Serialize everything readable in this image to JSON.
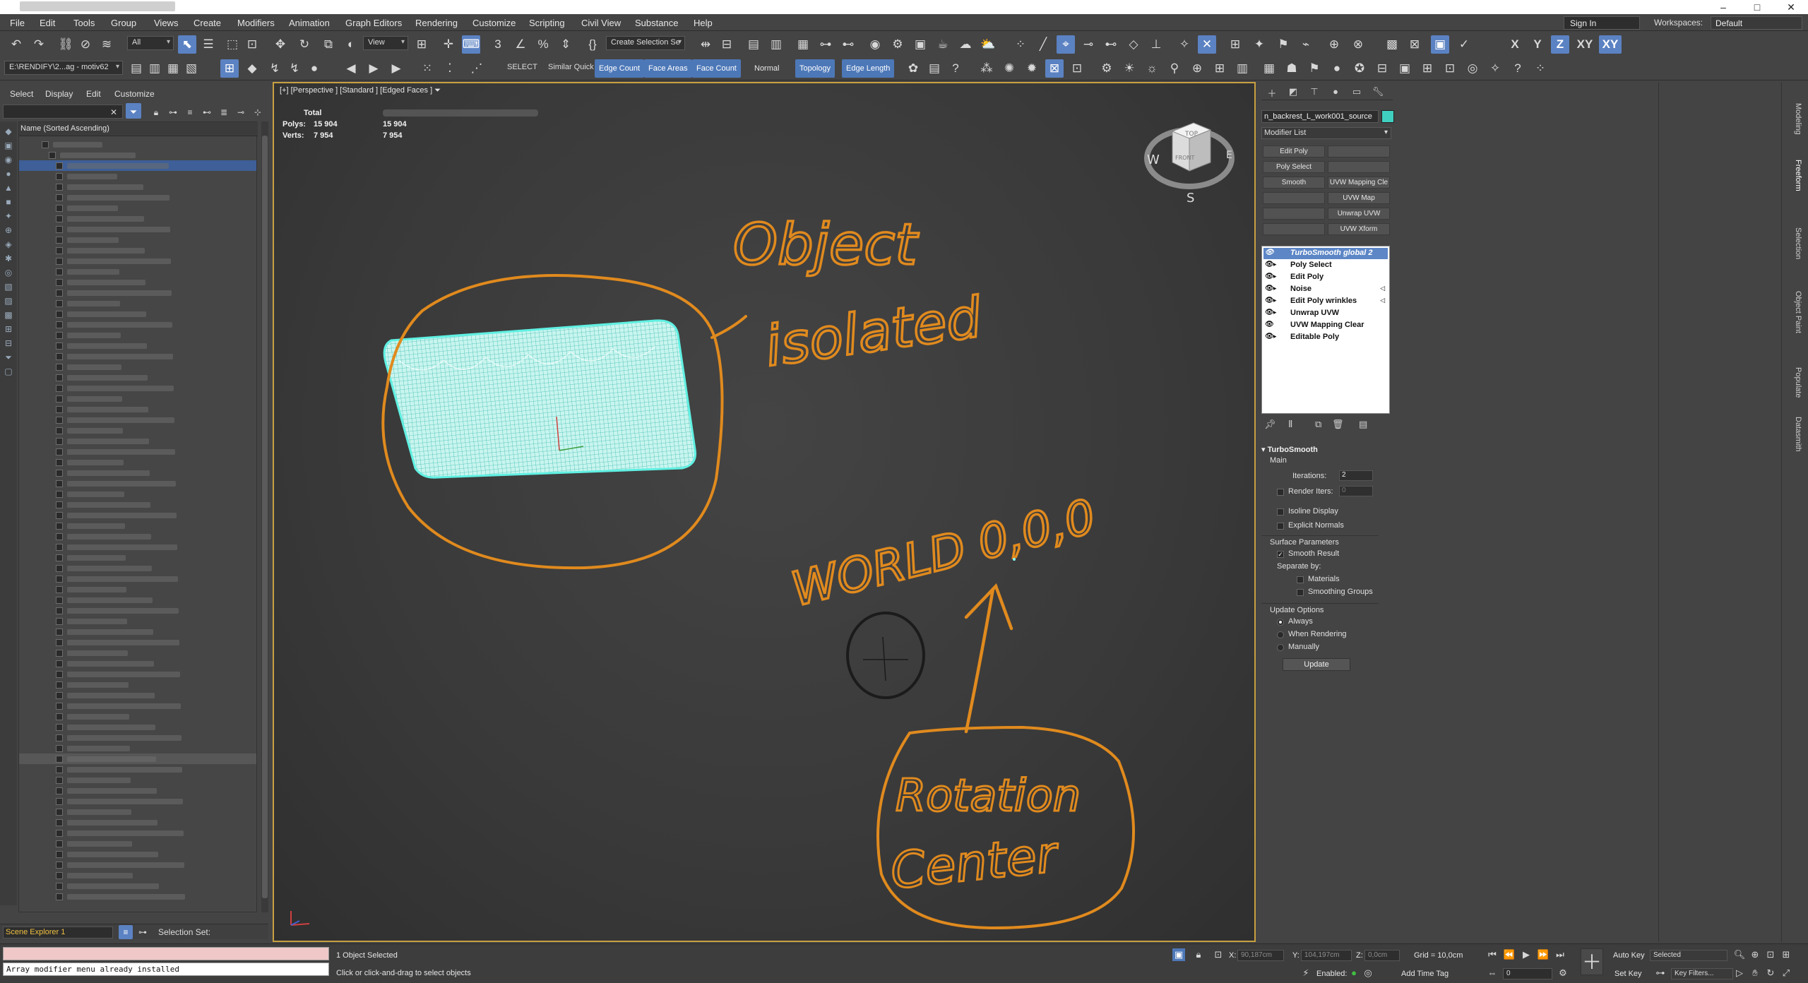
{
  "window": {
    "minimize": "–",
    "maximize": "□",
    "close": "✕"
  },
  "menu": [
    "File",
    "Edit",
    "Tools",
    "Group",
    "Views",
    "Create",
    "Modifiers",
    "Animation",
    "Graph Editors",
    "Rendering",
    "Customize",
    "Scripting",
    "Civil View",
    "Substance",
    "Help"
  ],
  "account": {
    "sign_in": "Sign In",
    "workspaces_label": "Workspaces:",
    "workspace": "Default"
  },
  "toolbar1": {
    "selection_filter": "All",
    "ref_coord": "View",
    "create_selection_set": "Create Selection Se"
  },
  "toolbar2": {
    "project_path": "E:\\RENDIFY\\2...ag - motiv62",
    "select_label": "SELECT",
    "similar_quick": "Similar Quick",
    "edge_count": "Edge Count",
    "face_areas": "Face Areas",
    "face_count": "Face Count",
    "normal": "Normal",
    "topology": "Topology",
    "edge_length": "Edge Length",
    "axis_x": "X",
    "axis_y": "Y",
    "axis_z": "Z",
    "axis_xy": "XY",
    "axis_xy2": "XY"
  },
  "scene_explorer": {
    "tabs": [
      "Select",
      "Display",
      "Edit",
      "Customize"
    ],
    "column_header": "Name (Sorted Ascending)",
    "explorer_name": "Scene Explorer 1",
    "selection_set_label": "Selection Set:"
  },
  "viewport": {
    "label": "[+] [Perspective ] [Standard ] [Edged Faces ]",
    "stats_total": "Total",
    "polys_label": "Polys:",
    "polys_value": "15 904",
    "polys_total": "15 904",
    "verts_label": "Verts:",
    "verts_value": "7 954",
    "verts_total": "7 954",
    "viewcube": {
      "top": "TOP",
      "front": "FRONT",
      "west": "W",
      "east": "E",
      "south": "S"
    },
    "annotations": {
      "isolated_1": "Object",
      "isolated_2": "isolated",
      "world": "WORLD 0,0,0",
      "rotation_1": "Rotation",
      "rotation_2": "Center"
    },
    "colors": {
      "annotation": "#e08a1e",
      "mesh": "#3fe0d0"
    }
  },
  "command_panel": {
    "object_name": "n_backrest_L_work001_source",
    "object_color": "#40d0c0",
    "modifier_list": "Modifier List",
    "mod_buttons": [
      "Edit Poly",
      "",
      "Poly Select",
      "",
      "Smooth",
      "UVW Mapping Cle",
      "",
      "UVW Map",
      "",
      "Unwrap UVW",
      "",
      "UVW Xform"
    ],
    "stack": [
      {
        "name": "TurboSmooth global 2",
        "selected": true,
        "arrow": false,
        "mark": ""
      },
      {
        "name": "Poly Select",
        "selected": false,
        "arrow": true,
        "mark": ""
      },
      {
        "name": "Edit Poly",
        "selected": false,
        "arrow": true,
        "mark": ""
      },
      {
        "name": "Noise",
        "selected": false,
        "arrow": true,
        "mark": "◁"
      },
      {
        "name": "Edit Poly wrinkles",
        "selected": false,
        "arrow": true,
        "mark": "◁"
      },
      {
        "name": "Unwrap UVW",
        "selected": false,
        "arrow": true,
        "mark": ""
      },
      {
        "name": "UVW Mapping Clear",
        "selected": false,
        "arrow": false,
        "mark": ""
      },
      {
        "name": "Editable Poly",
        "selected": false,
        "arrow": true,
        "mark": ""
      }
    ],
    "turbosmooth": {
      "title": "TurboSmooth",
      "main": "Main",
      "iterations_label": "Iterations:",
      "iterations": "2",
      "render_iters_label": "Render Iters:",
      "render_iters": "0",
      "isoline": "Isoline Display",
      "explicit_normals": "Explicit Normals",
      "surface_params": "Surface Parameters",
      "smooth_result": "Smooth Result",
      "separate_by": "Separate by:",
      "materials": "Materials",
      "smoothing_groups": "Smoothing Groups",
      "update_options": "Update Options",
      "always": "Always",
      "when_rendering": "When Rendering",
      "manually": "Manually",
      "update": "Update"
    },
    "side_tabs": [
      "Modeling",
      "Freeform",
      "Selection",
      "Object Paint",
      "Populate",
      "Datasmith"
    ]
  },
  "status": {
    "listener_output": "Array modifier menu already installed",
    "objects_selected": "1 Object Selected",
    "prompt": "Click or click-and-drag to select objects",
    "x_label": "X:",
    "x_val": "90,187cm",
    "y_label": "Y:",
    "y_val": "104,197cm",
    "z_label": "Z:",
    "z_val": "0,0cm",
    "grid": "Grid = 10,0cm",
    "enabled": "Enabled:",
    "add_time_tag": "Add Time Tag",
    "auto_key": "Auto Key",
    "set_key": "Set Key",
    "selected": "Selected",
    "key_filters": "Key Filters...",
    "frame": "0"
  }
}
